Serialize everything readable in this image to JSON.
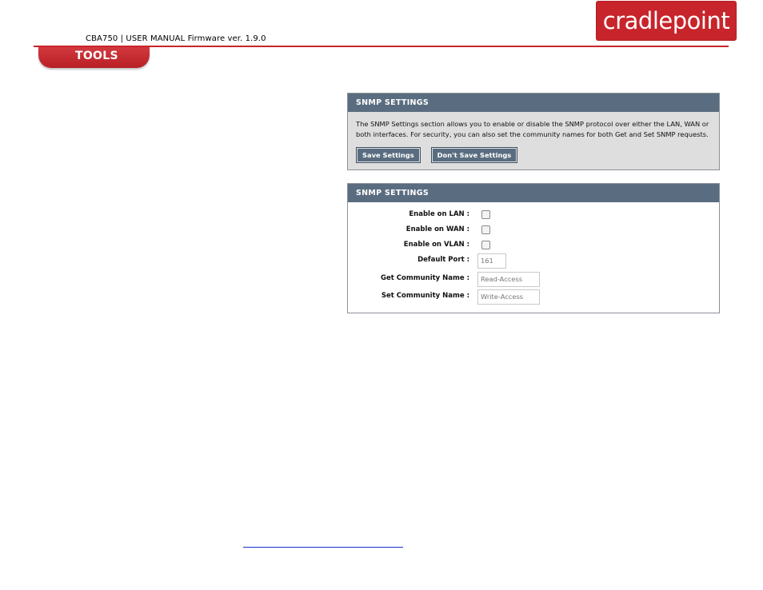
{
  "header": {
    "doc_title": "CBA750 | USER MANUAL Firmware ver. 1.9.0",
    "logo_text": "cradlepoint",
    "section_tab": "TOOLS"
  },
  "info_panel": {
    "title": "SNMP SETTINGS",
    "description": "The SNMP Settings section allows you to enable or disable the SNMP protocol over either the LAN, WAN or both interfaces. For security, you can also set the community names for both Get and Set SNMP requests.",
    "save_label": "Save Settings",
    "dont_save_label": "Don't Save Settings"
  },
  "settings_panel": {
    "title": "SNMP SETTINGS",
    "enable_lan_label": "Enable on LAN :",
    "enable_wan_label": "Enable on WAN :",
    "enable_vlan_label": "Enable on VLAN :",
    "default_port_label": "Default Port :",
    "default_port_value": "161",
    "get_community_label": "Get Community Name :",
    "get_community_value": "Read-Access",
    "set_community_label": "Set Community Name :",
    "set_community_value": "Write-Access"
  },
  "colors": {
    "brand_red": "#c8242b",
    "panel_header": "#5a6d80"
  }
}
